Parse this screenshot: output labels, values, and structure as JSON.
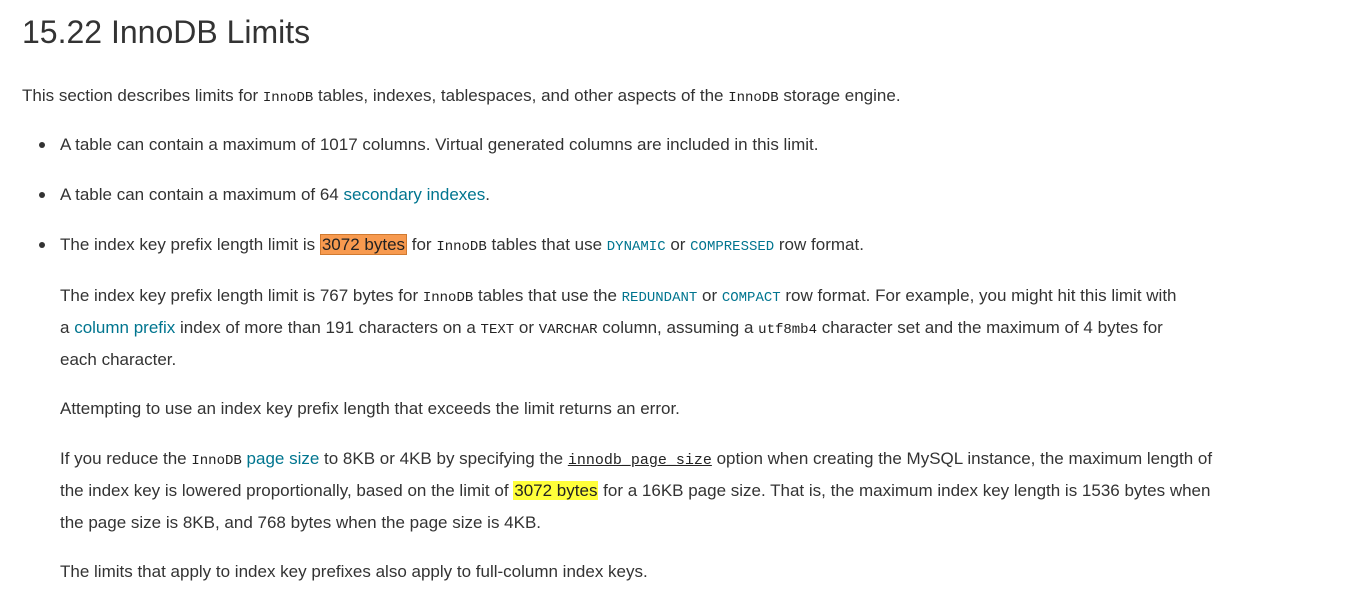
{
  "heading": "15.22 InnoDB Limits",
  "intro": {
    "t1": "This section describes limits for ",
    "c1": "InnoDB",
    "t2": " tables, indexes, tablespaces, and other aspects of the ",
    "c2": "InnoDB",
    "t3": " storage engine."
  },
  "li1": {
    "t1": "A table can contain a maximum of 1017 columns. Virtual generated columns are included in this limit."
  },
  "li2": {
    "t1": "A table can contain a maximum of 64 ",
    "link": "secondary indexes",
    "t2": "."
  },
  "li3": {
    "t1": "The index key prefix length limit is ",
    "hl": "3072 bytes",
    "t2": " for ",
    "c1": "InnoDB",
    "t3": " tables that use ",
    "l1": "DYNAMIC",
    "t4": " or ",
    "l2": "COMPRESSED",
    "t5": " row format."
  },
  "sub1": {
    "t1": "The index key prefix length limit is 767 bytes for ",
    "c1": "InnoDB",
    "t2": " tables that use the ",
    "l1": "REDUNDANT",
    "t3": " or ",
    "l2": "COMPACT",
    "t4": " row format. For example, you might hit this limit with",
    "t5": "a ",
    "l3": "column prefix",
    "t6": " index of more than 191 characters on a ",
    "c2": "TEXT",
    "t7": " or ",
    "c3": "VARCHAR",
    "t8": " column, assuming a ",
    "c4": "utf8mb4",
    "t9": " character set and the maximum of 4 bytes for",
    "t10": "each character."
  },
  "sub2": {
    "t1": "Attempting to use an index key prefix length that exceeds the limit returns an error."
  },
  "sub3": {
    "t1": "If you reduce the ",
    "c1": "InnoDB",
    "t2": " ",
    "l1": "page size",
    "t3": " to 8KB or 4KB by specifying the ",
    "opt": "innodb_page_size",
    "t4": " option when creating the MySQL instance, the maximum length of",
    "t5": "the index key is lowered proportionally, based on the limit of ",
    "hl": "3072 bytes",
    "t6": " for a 16KB page size. That is, the maximum index key length is 1536 bytes when",
    "t7": "the page size is 8KB, and 768 bytes when the page size is 4KB."
  },
  "sub4": {
    "t1": "The limits that apply to index key prefixes also apply to full-column index keys."
  },
  "colors": {
    "link": "#00758f",
    "text": "#333333",
    "highlight_orange": "#f79a4f",
    "highlight_yellow": "#ffff3a"
  }
}
